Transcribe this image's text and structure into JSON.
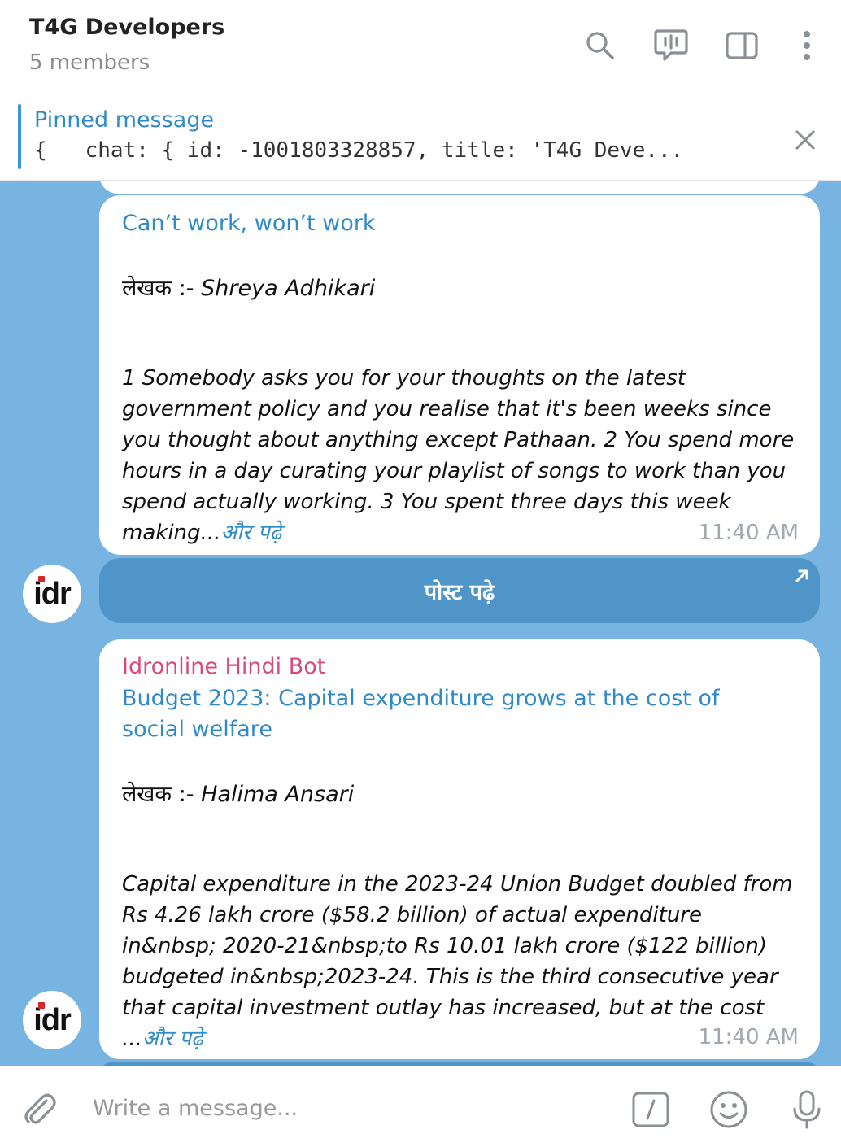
{
  "header": {
    "title": "T4G Developers",
    "subtitle": "5 members",
    "icons": [
      "search-icon",
      "voice-chat-icon",
      "sidebar-toggle-icon",
      "more-vertical-icon"
    ]
  },
  "pinned": {
    "label": "Pinned message",
    "text": "{   chat: { id: -1001803328857, title: 'T4G Deve..."
  },
  "messages": [
    {
      "title": "Can’t work, won’t work",
      "author_prefix": "लेखक :- ",
      "author": "Shreya Adhikari",
      "body": " 1 Somebody asks you for your thoughts on the latest government policy and you realise that it's been weeks since you thought about anything except Pathaan. 2 You spend more hours in a day curating your playlist of songs to work than you spend actually working. 3 You spent three days this week making...",
      "read_more": "और पढ़े",
      "time": "11:40 AM",
      "button": "पोस्ट पढ़े",
      "avatar_text": "idr"
    },
    {
      "sender": "Idronline Hindi Bot",
      "title": "Budget 2023: Capital expenditure grows at the cost of social welfare",
      "author_prefix": "लेखक :- ",
      "author": "Halima Ansari",
      "body": " Capital expenditure in the 2023-24 Union Budget doubled from Rs 4.26 lakh crore ($58.2 billion) of actual expenditure in&nbsp; 2020-21&nbsp;to Rs 10.01 lakh crore ($122 billion) budgeted in&nbsp;2023-24. This is the third consecutive year that capital investment outlay has increased, but at the cost ...",
      "read_more": "और पढ़े",
      "time": "11:40 AM",
      "avatar_text": "idr"
    }
  ],
  "composer": {
    "placeholder": "Write a message...",
    "icons": [
      "attach-icon",
      "commands-icon",
      "emoji-icon",
      "microphone-icon"
    ]
  },
  "colors": {
    "chat_background": "#77b4e1",
    "accent": "#2f8ac9",
    "sender": "#d64a7d",
    "button": "#4f95c8"
  }
}
